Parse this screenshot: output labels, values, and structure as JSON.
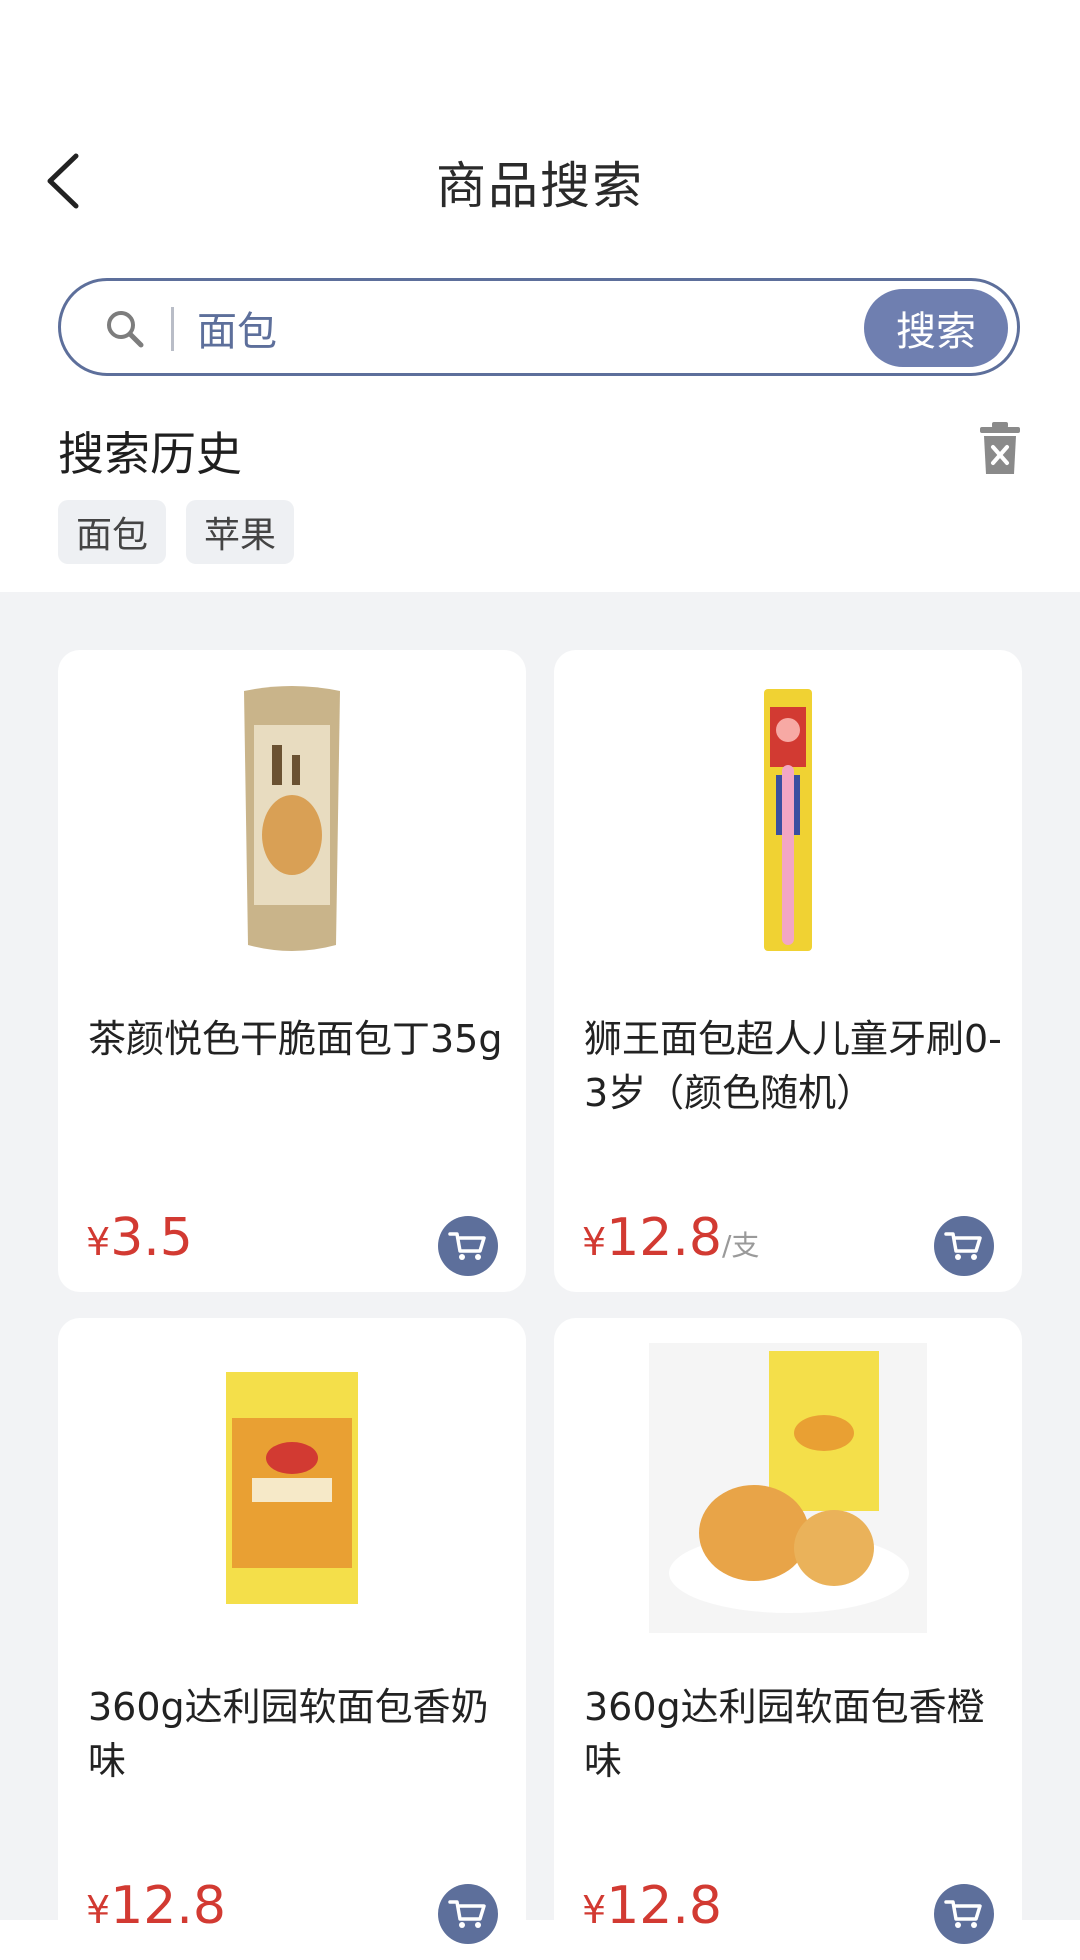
{
  "header": {
    "title": "商品搜索"
  },
  "search": {
    "value": "面包",
    "button_label": "搜索"
  },
  "history": {
    "title": "搜索历史",
    "tags": [
      "面包",
      "苹果"
    ]
  },
  "products": [
    {
      "name": "茶颜悦色干脆面包丁35g",
      "currency": "¥",
      "price": "3.5",
      "unit": ""
    },
    {
      "name": "狮王面包超人儿童牙刷0-3岁（颜色随机）",
      "currency": "¥",
      "price": "12.8",
      "unit": "/支"
    },
    {
      "name": "360g达利园软面包香奶味",
      "currency": "¥",
      "price": "12.8",
      "unit": ""
    },
    {
      "name": "360g达利园软面包香橙味",
      "currency": "¥",
      "price": "12.8",
      "unit": ""
    }
  ],
  "colors": {
    "accent": "#5d6f9b",
    "price": "#d23a32",
    "background": "#f2f3f5"
  },
  "icons": {
    "back": "chevron-left-icon",
    "search": "magnifier-icon",
    "trash": "trash-icon",
    "cart": "cart-icon"
  }
}
